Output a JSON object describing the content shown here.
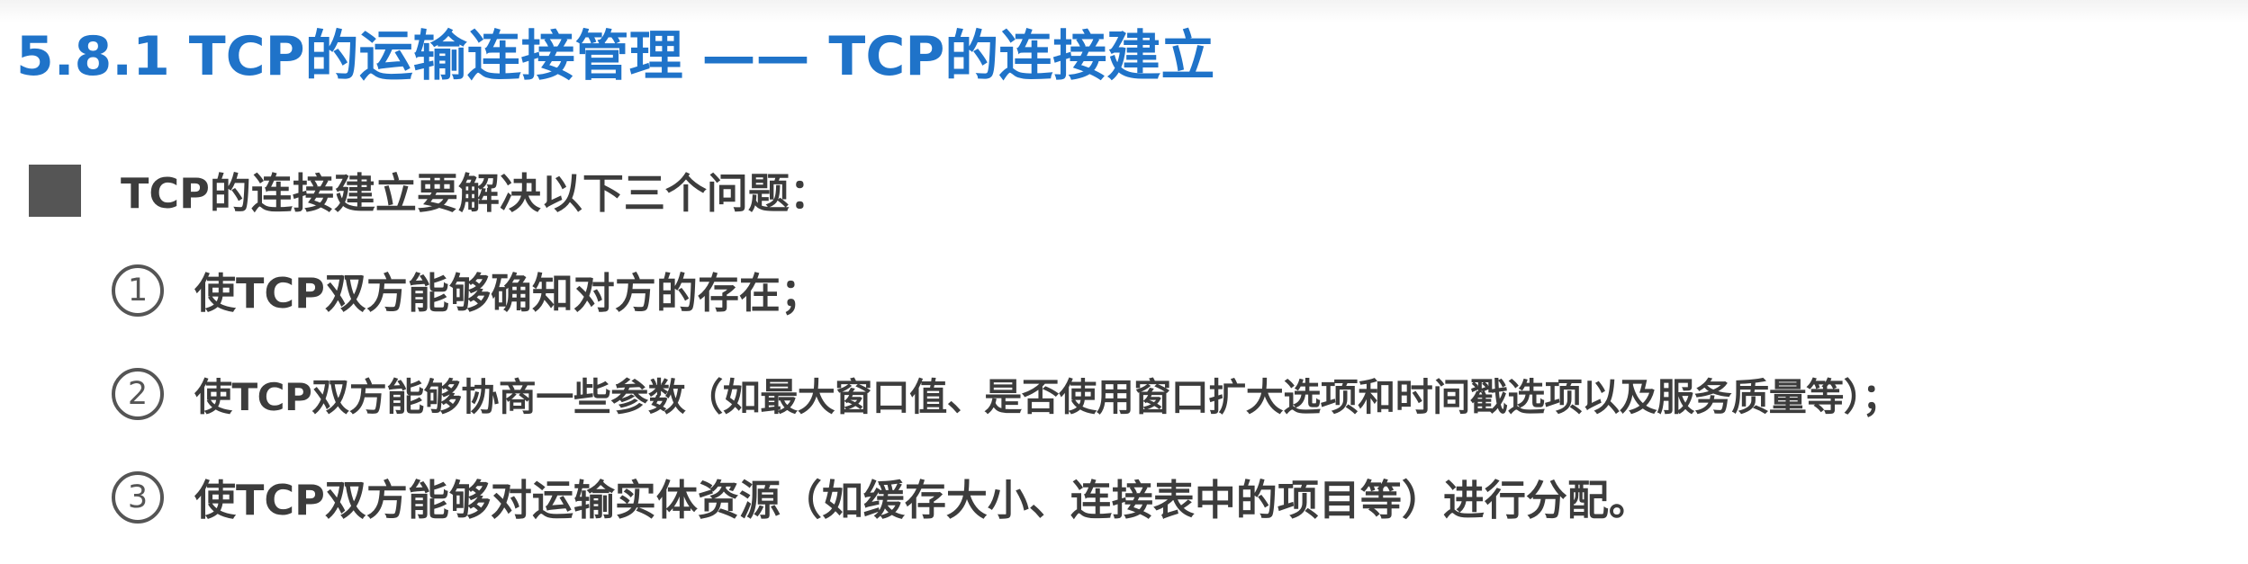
{
  "slide": {
    "title": "5.8.1 TCP的运输连接管理 —— TCP的连接建立",
    "title_color": "#1f73c9",
    "main_point": "TCP的连接建立要解决以下三个问题：",
    "items": [
      {
        "number": "1",
        "text": "使TCP双方能够确知对方的存在；"
      },
      {
        "number": "2",
        "text": "使TCP双方能够协商一些参数（如最大窗口值、是否使用窗口扩大选项和时间戳选项以及服务质量等）；"
      },
      {
        "number": "3",
        "text": "使TCP双方能够对运输实体资源（如缓存大小、连接表中的项目等）进行分配。"
      }
    ]
  }
}
